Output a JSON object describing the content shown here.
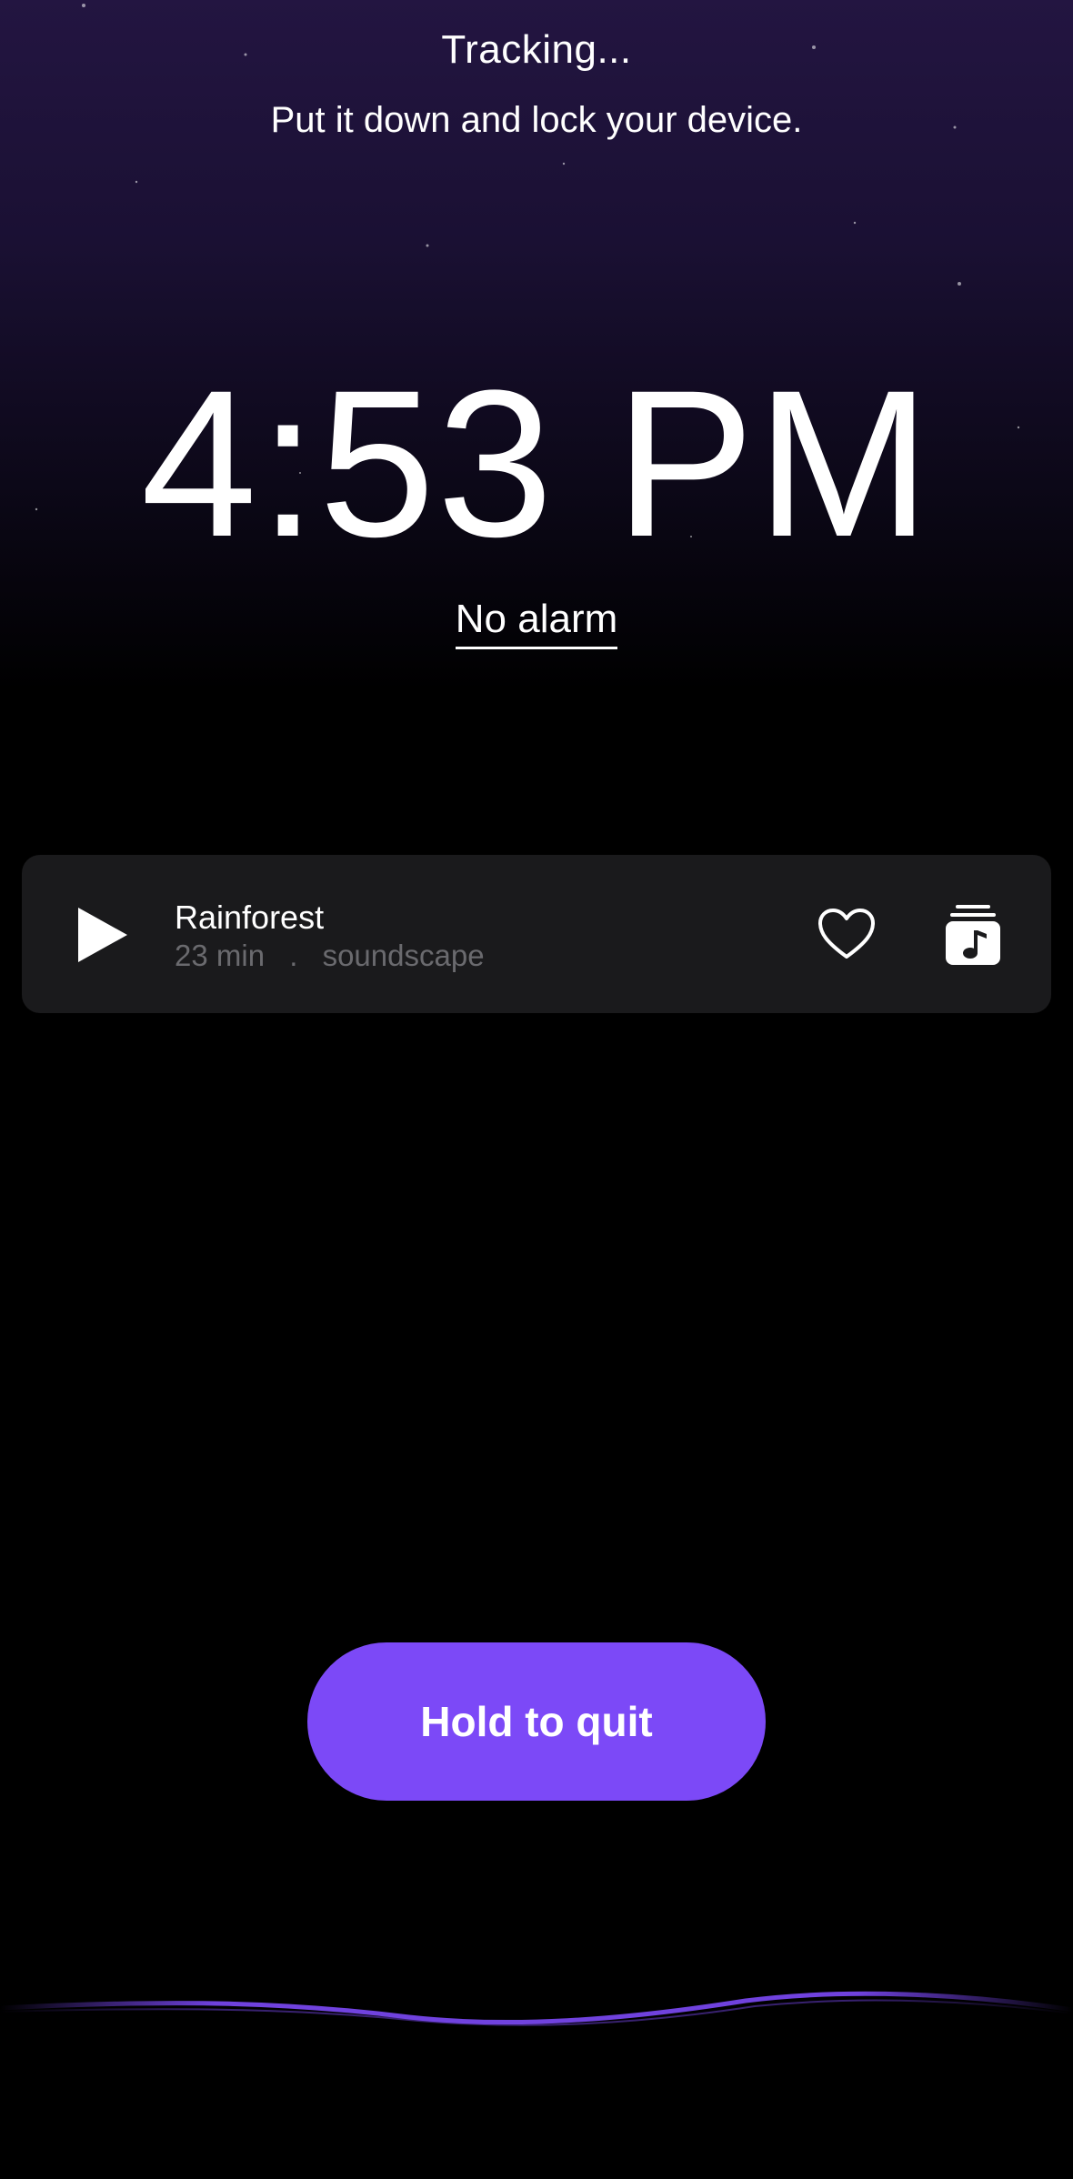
{
  "status": {
    "title": "Tracking...",
    "subtitle": "Put it down and lock your device."
  },
  "clock": {
    "time": "4:53 PM"
  },
  "alarm": {
    "label": "No alarm"
  },
  "player": {
    "track_title": "Rainforest",
    "duration": "23 min",
    "separator": ".",
    "category": "soundscape",
    "icons": {
      "play": "play-icon",
      "favorite": "heart-icon",
      "playlist": "music-playlist-icon"
    }
  },
  "quit_button": {
    "label": "Hold to quit"
  },
  "colors": {
    "accent": "#7c49f7",
    "card_background": "#1a1a1c",
    "meta_text": "#6a6a6e",
    "sky_top": "#231541"
  }
}
